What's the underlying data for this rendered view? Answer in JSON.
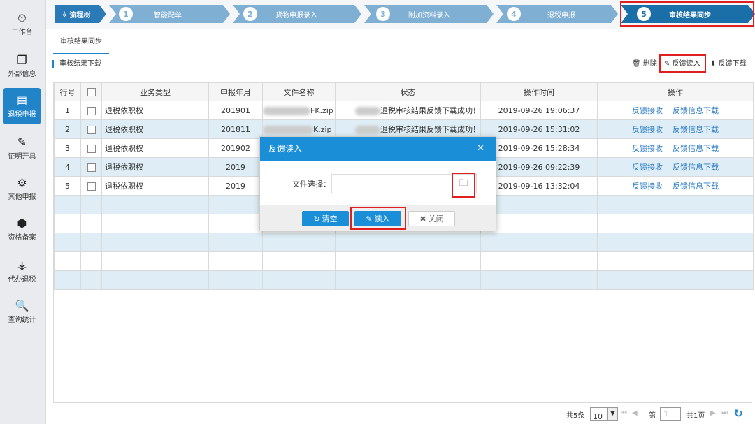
{
  "sidebar": {
    "items": [
      {
        "label": "工作台",
        "icon": "dashboard-icon",
        "glyph": "⏲"
      },
      {
        "label": "外部信息",
        "icon": "windows-icon",
        "glyph": "❐"
      },
      {
        "label": "退税申报",
        "icon": "document-icon",
        "glyph": "▤"
      },
      {
        "label": "证明开具",
        "icon": "edit-icon",
        "glyph": "✎"
      },
      {
        "label": "其他申报",
        "icon": "gears-icon",
        "glyph": "⚙"
      },
      {
        "label": "资格备案",
        "icon": "cube-icon",
        "glyph": "⬢"
      },
      {
        "label": "代办退税",
        "icon": "sitemap-icon",
        "glyph": "⚶"
      },
      {
        "label": "查询统计",
        "icon": "search-icon",
        "glyph": "🔍"
      }
    ]
  },
  "steps": {
    "root": "流程树",
    "items": [
      {
        "num": "1",
        "label": "智能配单"
      },
      {
        "num": "2",
        "label": "货物申报录入"
      },
      {
        "num": "3",
        "label": "附加资料录入"
      },
      {
        "num": "4",
        "label": "退税申报"
      },
      {
        "num": "5",
        "label": "审核结果同步"
      }
    ]
  },
  "tab": {
    "label": "审核结果同步"
  },
  "section": {
    "title": "审核结果下载"
  },
  "toolbar": {
    "delete": "删除",
    "feedback_read": "反馈读入",
    "feedback_download": "反馈下载"
  },
  "table": {
    "headers": [
      "行号",
      "",
      "业务类型",
      "申报年月",
      "文件名称",
      "状态",
      "操作时间",
      "操作"
    ],
    "rows": [
      {
        "no": "1",
        "type": "退税依职权",
        "period": "201901",
        "file": "FK.zip",
        "status": "退税审核结果反馈下载成功！",
        "time": "2019-09-26 19:06:37",
        "op1": "反馈接收",
        "op2": "反馈信息下载"
      },
      {
        "no": "2",
        "type": "退税依职权",
        "period": "201811",
        "file": "K.zip",
        "status": "退税审核结果反馈下载成功！",
        "time": "2019-09-26 15:31:02",
        "op1": "反馈接收",
        "op2": "反馈信息下载"
      },
      {
        "no": "3",
        "type": "退税依职权",
        "period": "201902",
        "file": "",
        "status": "",
        "time": "2019-09-26 15:28:34",
        "op1": "反馈接收",
        "op2": "反馈信息下载"
      },
      {
        "no": "4",
        "type": "退税依职权",
        "period": "2019",
        "file": "",
        "status": "",
        "time": "2019-09-26 09:22:39",
        "op1": "反馈接收",
        "op2": "反馈信息下载"
      },
      {
        "no": "5",
        "type": "退税依职权",
        "period": "2019",
        "file": "",
        "status": "",
        "time": "2019-09-16 13:32:04",
        "op1": "反馈接收",
        "op2": "反馈信息下载"
      }
    ]
  },
  "pager": {
    "total": "共5条",
    "page_size": "10",
    "page_label": "第",
    "page": "1",
    "total_pages": "共1页"
  },
  "modal": {
    "title": "反馈读入",
    "file_label": "文件选择：",
    "clear": "清空",
    "read": "读入",
    "close": "关闭"
  },
  "colors": {
    "accent": "#2184c9",
    "highlight": "#e02020",
    "step_active": "#1a6fa8",
    "step_inactive": "#7fb0d3"
  }
}
